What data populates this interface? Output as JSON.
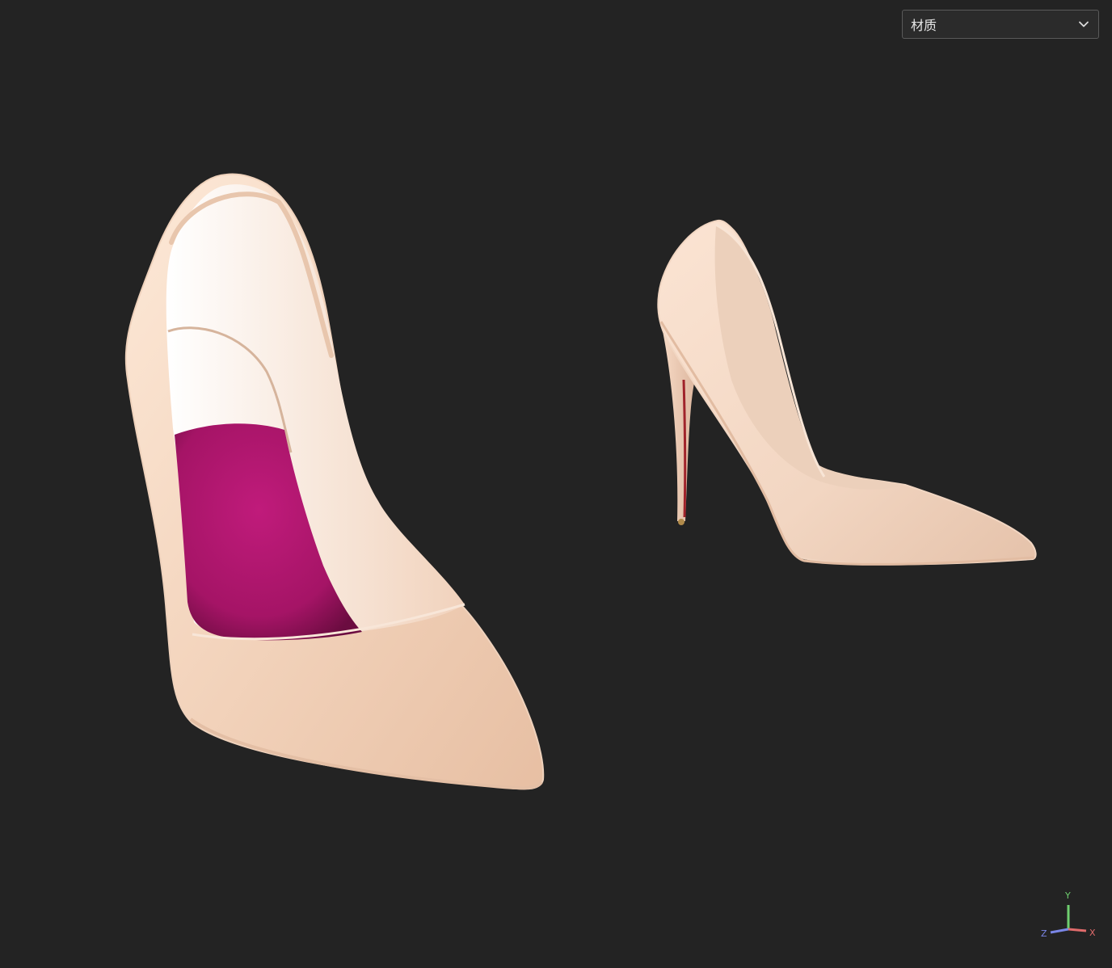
{
  "toolbar": {
    "material_dropdown": {
      "selected": "材质",
      "icon": "chevron-down-icon"
    }
  },
  "axis_gizmo": {
    "y_label": "Y",
    "x_label": "X",
    "z_label": "Z",
    "colors": {
      "y": "#6fcf6f",
      "x": "#e06b6b",
      "z": "#7a86e6"
    }
  },
  "scene": {
    "objects": [
      "high-heel-shoe-front",
      "high-heel-shoe-side"
    ],
    "colors": {
      "background": "#232323",
      "shoe_body": "#f3d9c4",
      "insole": "#b3156f",
      "sole_accent": "#a0232b"
    }
  }
}
